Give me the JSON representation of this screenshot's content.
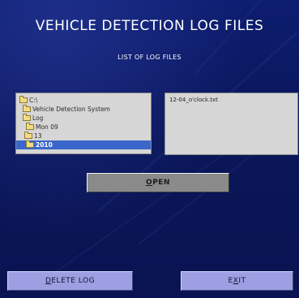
{
  "header": {
    "title": "VEHICLE DETECTION LOG FILES",
    "subtitle": "LIST OF LOG FILES"
  },
  "directory_tree": {
    "items": [
      {
        "label": "C:\\",
        "selected": false
      },
      {
        "label": "Vehicle Detection System",
        "selected": false
      },
      {
        "label": "Log",
        "selected": false
      },
      {
        "label": "Mon 09",
        "selected": false
      },
      {
        "label": "13",
        "selected": false
      },
      {
        "label": "2010",
        "selected": true
      }
    ]
  },
  "file_list": {
    "items": [
      "12-04_o'clock.txt"
    ]
  },
  "buttons": {
    "open": {
      "mnemonic": "O",
      "rest": "PEN"
    },
    "delete_log": {
      "mnemonic": "D",
      "rest": "ELETE LOG"
    },
    "exit": {
      "pre": "E",
      "mnemonic": "X",
      "rest": "IT"
    }
  },
  "colors": {
    "background": "#0a1659",
    "list_background": "#d6d6d6",
    "selection": "#3a67c9",
    "open_button": "#8a8a8a",
    "action_button": "#9e9ee2"
  }
}
